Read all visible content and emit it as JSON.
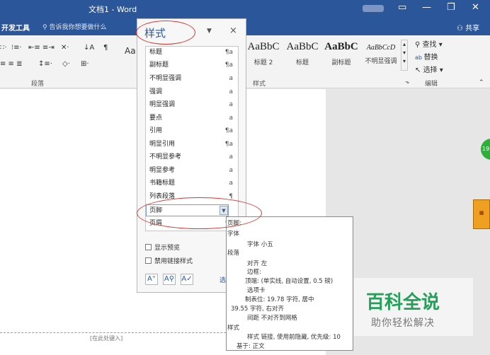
{
  "window": {
    "title": "文档1 - Word",
    "controls": [
      "▭",
      "—",
      "❐",
      "✕"
    ]
  },
  "tabs": {
    "developer": "开发工具",
    "tell_me": "告诉我你想要做什么",
    "share": "共享"
  },
  "ribbon": {
    "paragraph_label": "段落",
    "styles_label": "样式",
    "editing_label": "编辑",
    "gallery": [
      {
        "sample": "AaBbC",
        "name": "标题 2"
      },
      {
        "sample": "AaBbC",
        "name": "标题"
      },
      {
        "sample": "AaBbC",
        "name": "副标题"
      },
      {
        "sample": "AaBbCcD",
        "name": "不明显强调"
      }
    ],
    "find": "查找",
    "replace": "替换",
    "select": "选择"
  },
  "styles_pane": {
    "title": "样式",
    "close": "×",
    "items": [
      {
        "label": "标题",
        "mark": "¶a"
      },
      {
        "label": "副标题",
        "mark": "¶a"
      },
      {
        "label": "不明显强调",
        "mark": "a"
      },
      {
        "label": "强调",
        "mark": "a"
      },
      {
        "label": "明显强调",
        "mark": "a"
      },
      {
        "label": "要点",
        "mark": "a"
      },
      {
        "label": "引用",
        "mark": "¶a"
      },
      {
        "label": "明显引用",
        "mark": "¶a"
      },
      {
        "label": "不明显参考",
        "mark": "a"
      },
      {
        "label": "明显参考",
        "mark": "a"
      },
      {
        "label": "书籍标题",
        "mark": "a"
      },
      {
        "label": "列表段落",
        "mark": "¶"
      },
      {
        "label": "页脚",
        "mark": "▼"
      },
      {
        "label": "页眉",
        "mark": "¶a"
      }
    ],
    "show_preview": "显示预览",
    "disable_linked": "禁用链接样式",
    "options_link": "选"
  },
  "tooltip": {
    "header": "页脚:",
    "font_heading": "字体",
    "font_value": "字体 小五",
    "para_heading": "段落",
    "align": "对齐 左",
    "border": "边框:",
    "border_detail": "顶端: (单实线, 自动设置, 0.5 磅)",
    "tabs_heading": "选项卡",
    "tab_center": "制表位: 19.78 字符, 居中",
    "tab_right": "39.55 字符, 右对齐",
    "spacing": "间距 不对齐到网格",
    "style_heading": "样式",
    "style_detail": "样式 链接, 使用前隐藏, 优先级: 10",
    "based_on": "基于: 正文"
  },
  "document": {
    "footer_placeholder": "[在此处键入]"
  },
  "watermark": {
    "title": "百科全说",
    "subtitle": "助你轻松解决"
  }
}
